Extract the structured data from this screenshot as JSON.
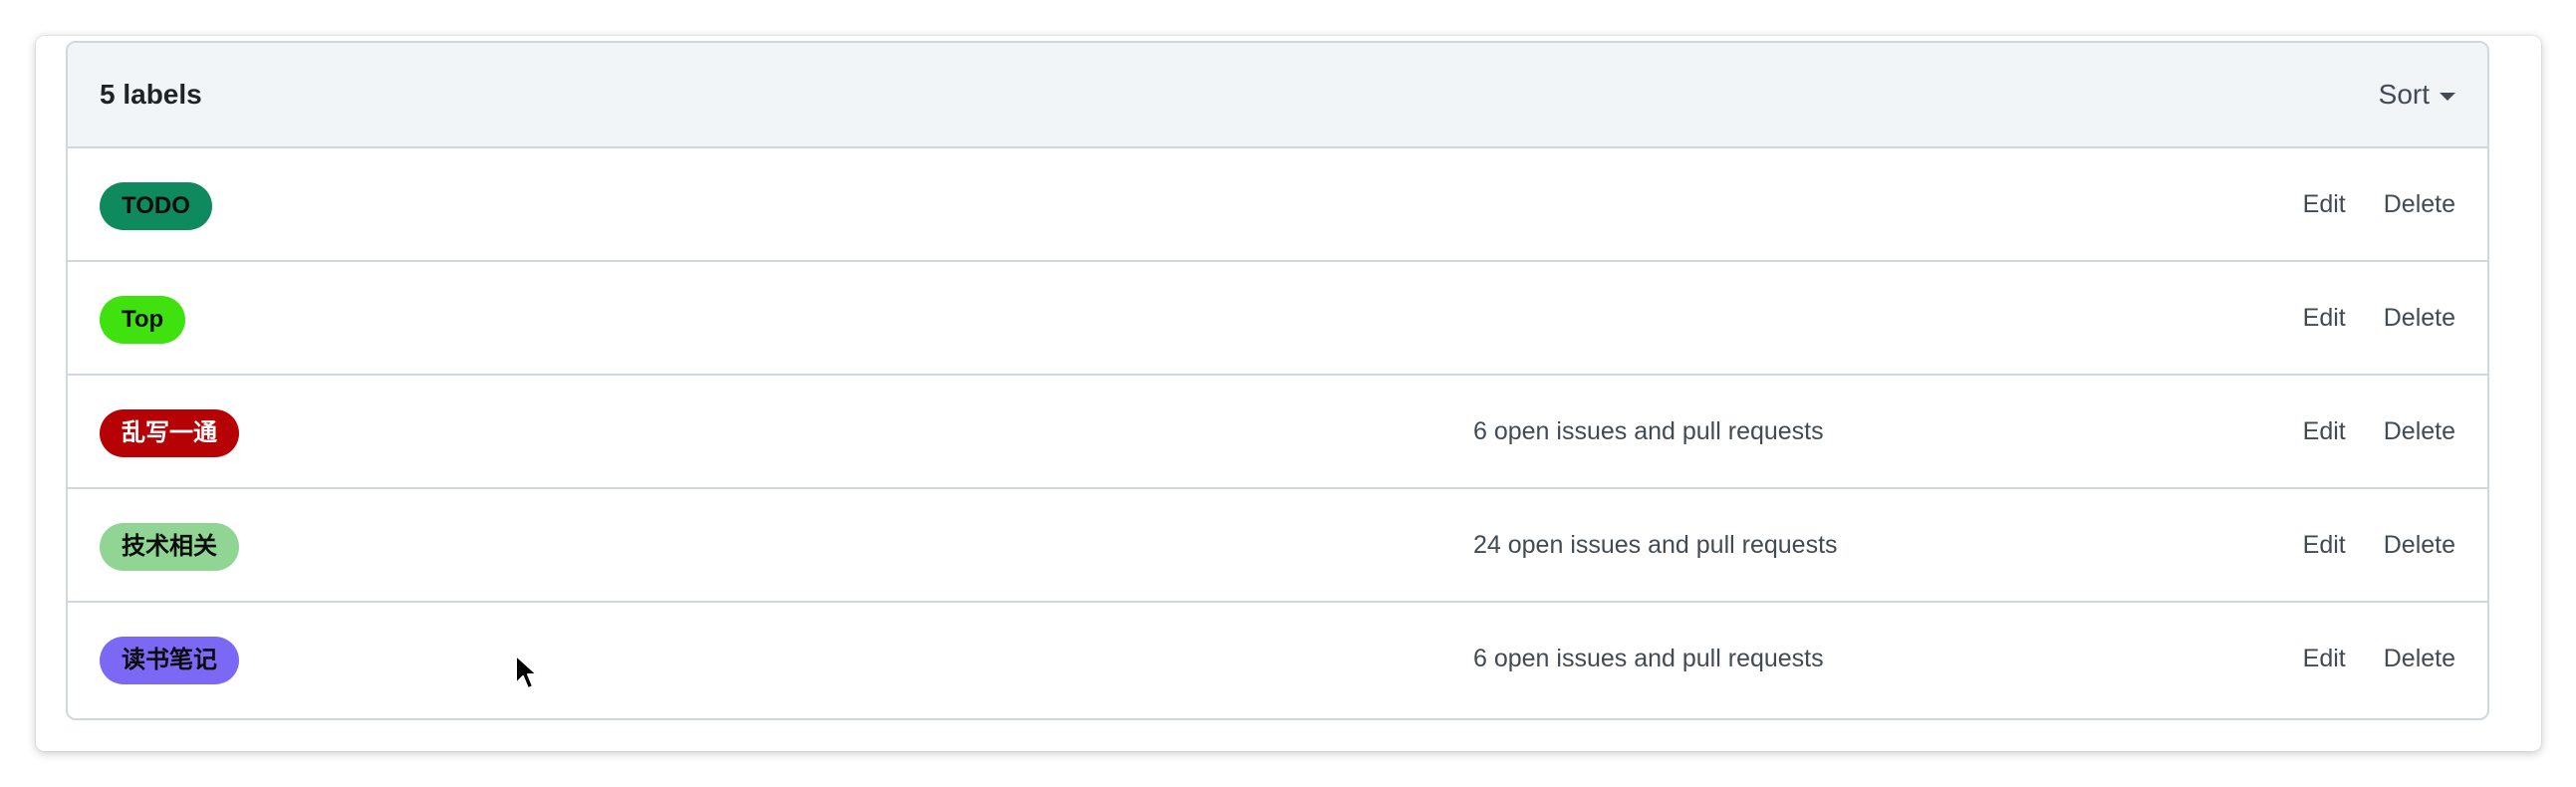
{
  "header": {
    "count_label": "5 labels",
    "sort_label": "Sort"
  },
  "labels": [
    {
      "name": "TODO",
      "color": "#0f8a5f",
      "text_color": "#0b0d0c",
      "description": "",
      "edit_label": "Edit",
      "delete_label": "Delete"
    },
    {
      "name": "Top",
      "color": "#3fe10f",
      "text_color": "#0b0d0c",
      "description": "",
      "edit_label": "Edit",
      "delete_label": "Delete"
    },
    {
      "name": "乱写一通",
      "color": "#b60205",
      "text_color": "#ffffff",
      "description": "6 open issues and pull requests",
      "edit_label": "Edit",
      "delete_label": "Delete"
    },
    {
      "name": "技术相关",
      "color": "#90d594",
      "text_color": "#0b0d0c",
      "description": "24 open issues and pull requests",
      "edit_label": "Edit",
      "delete_label": "Delete"
    },
    {
      "name": "读书笔记",
      "color": "#7b69f5",
      "text_color": "#0b0d0c",
      "description": "6 open issues and pull requests",
      "edit_label": "Edit",
      "delete_label": "Delete"
    }
  ]
}
